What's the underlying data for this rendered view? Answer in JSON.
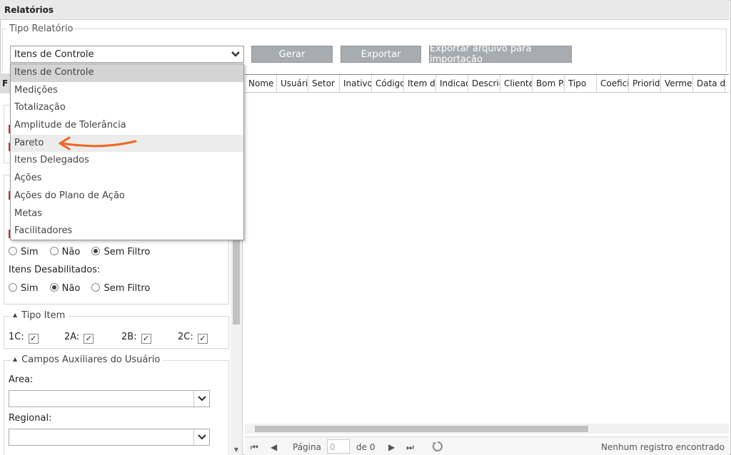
{
  "title": "Relatórios",
  "tipo_relatorio": {
    "legend": "Tipo Relatório",
    "selected": "Itens de Controle",
    "options": [
      "Itens de Controle",
      "Medições",
      "Totalização",
      "Amplitude de Tolerância",
      "Pareto",
      "Itens Delegados",
      "Ações",
      "Ações do Plano de Ação",
      "Metas",
      "Facilitadores"
    ]
  },
  "buttons": {
    "gerar": "Gerar",
    "exportar": "Exportar",
    "exportar_arquivo": "Exportar arquivo para importação"
  },
  "left_panel": {
    "tab_label": "F",
    "filter1": {
      "sim": "Sim",
      "nao": "Não",
      "sem_filtro": "Sem Filtro",
      "selected": "sem_filtro"
    },
    "itens_desabilitados": {
      "label": "Itens Desabilitados:",
      "sim": "Sim",
      "nao": "Não",
      "sem_filtro": "Sem Filtro",
      "selected": "nao"
    },
    "tipo_item": {
      "legend": "Tipo Item",
      "items": [
        "1C:",
        "2A:",
        "2B:",
        "2C:"
      ]
    },
    "campos_aux": {
      "legend": "Campos Auxiliares do Usuário",
      "area_label": "Area:",
      "regional_label": "Regional:"
    }
  },
  "grid": {
    "columns": [
      "Nome",
      "Usuário",
      "Setor",
      "Inativo",
      "Código",
      "Item de",
      "Indicad",
      "Descriç",
      "Cliente",
      "Bom Pa",
      "Tipo",
      "Coefici",
      "Priorid",
      "Vermel",
      "Data d"
    ]
  },
  "pager": {
    "page_label": "Página",
    "page_value": "0",
    "of_label": "de 0",
    "status": "Nenhum registro encontrado"
  },
  "icons": {
    "select_arrow": "chevron-down-icon",
    "refresh": "refresh-icon"
  },
  "colors": {
    "button_bg": "#a7acb1",
    "annotation_arrow": "#f26522"
  }
}
